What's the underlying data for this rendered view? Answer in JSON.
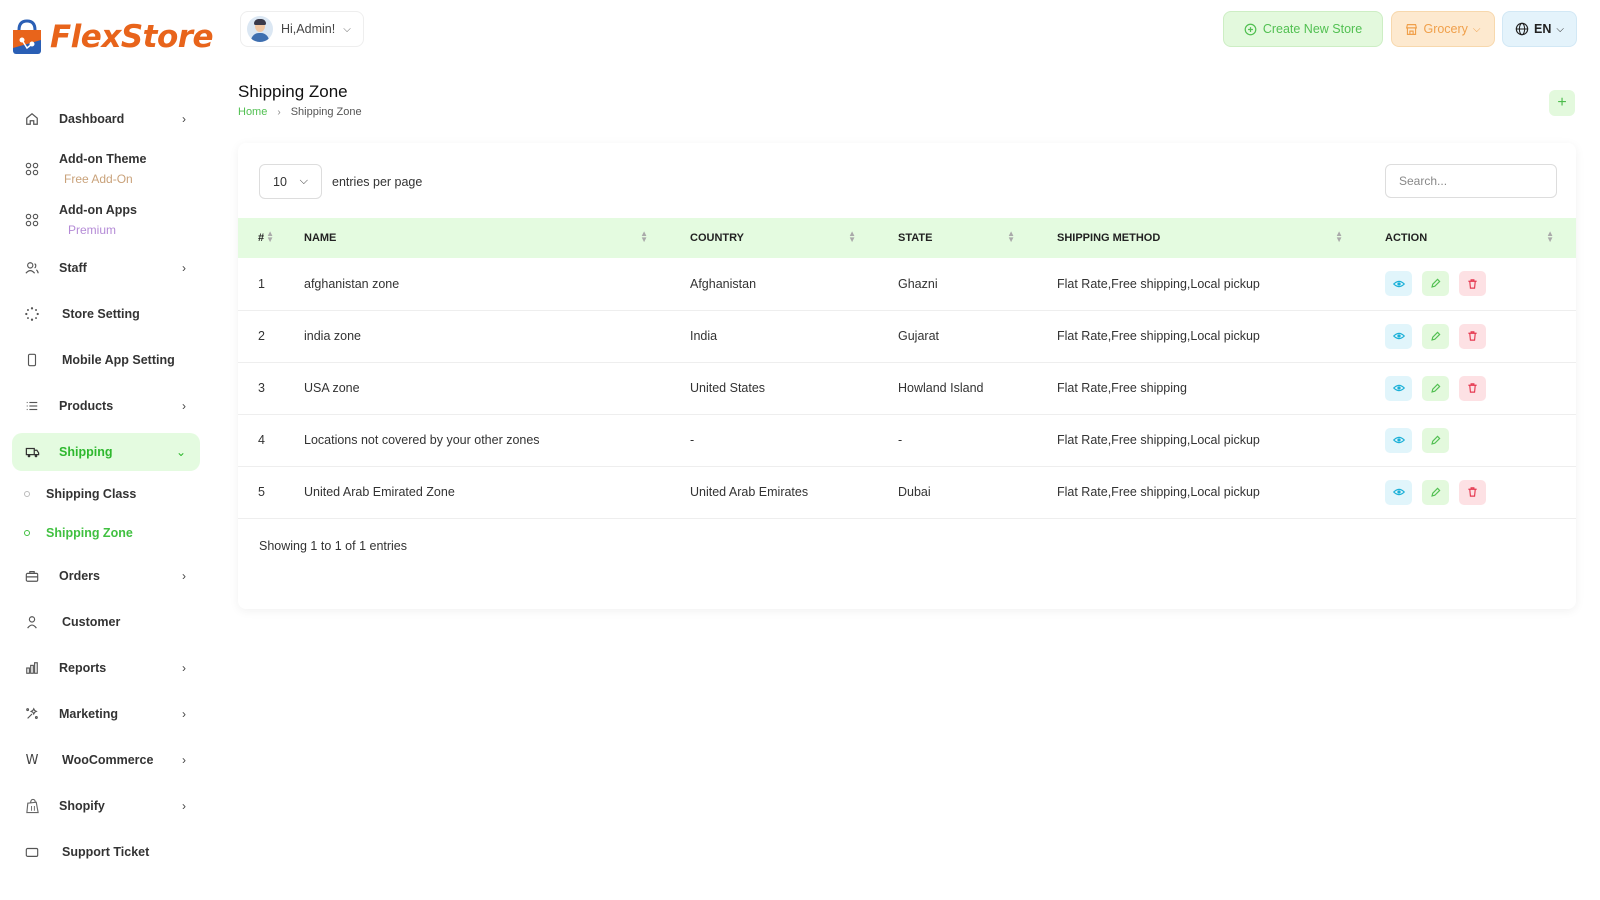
{
  "brand": {
    "name": "FlexStore"
  },
  "colors": {
    "accent": "#52c052",
    "accent_bg": "#e4fbe0",
    "brand": "#e8641b",
    "danger": "#e53950",
    "info": "#1ab0d8",
    "warning": "#f0a04b"
  },
  "header": {
    "user_greeting": "Hi,Admin!",
    "create_store_label": "Create New Store",
    "store_type_label": "Grocery",
    "language_label": "EN"
  },
  "sidebar": {
    "items": [
      {
        "label": "Dashboard",
        "icon": "home-icon"
      },
      {
        "label": "Add-on Theme",
        "sub": "Free Add-On",
        "icon": "grid-icon"
      },
      {
        "label": "Add-on Apps",
        "sub": "Premium",
        "icon": "grid-icon"
      },
      {
        "label": "Staff",
        "icon": "users-icon"
      },
      {
        "label": "Store Setting",
        "icon": "loader-icon"
      },
      {
        "label": "Mobile App Setting",
        "icon": "mobile-icon"
      },
      {
        "label": "Products",
        "icon": "list-icon"
      },
      {
        "label": "Shipping",
        "icon": "truck-icon"
      },
      {
        "label": "Orders",
        "icon": "briefcase-icon"
      },
      {
        "label": "Customer",
        "icon": "user-icon"
      },
      {
        "label": "Reports",
        "icon": "chart-icon"
      },
      {
        "label": "Marketing",
        "icon": "sparkle-icon"
      },
      {
        "label": "WooCommerce",
        "icon": "woo-icon"
      },
      {
        "label": "Shopify",
        "icon": "shopify-icon"
      },
      {
        "label": "Support Ticket",
        "icon": "ticket-icon"
      }
    ],
    "shipping_sub": [
      {
        "label": "Shipping Class"
      },
      {
        "label": "Shipping Zone"
      }
    ]
  },
  "page": {
    "title": "Shipping Zone",
    "breadcrumb": {
      "home": "Home",
      "current": "Shipping Zone"
    },
    "add_label": "+"
  },
  "table": {
    "per_page_value": "10",
    "per_page_label": "entries per page",
    "search_placeholder": "Search...",
    "columns": [
      "#",
      "NAME",
      "COUNTRY",
      "STATE",
      "SHIPPING METHOD",
      "ACTION"
    ],
    "rows": [
      {
        "num": "1",
        "name": "afghanistan zone",
        "country": "Afghanistan",
        "state": "Ghazni",
        "method": "Flat Rate,Free shipping,Local pickup",
        "deletable": true
      },
      {
        "num": "2",
        "name": "india zone",
        "country": "India",
        "state": "Gujarat",
        "method": "Flat Rate,Free shipping,Local pickup",
        "deletable": true
      },
      {
        "num": "3",
        "name": "USA zone",
        "country": "United States",
        "state": "Howland Island",
        "method": "Flat Rate,Free shipping",
        "deletable": true
      },
      {
        "num": "4",
        "name": "Locations not covered by your other zones",
        "country": "-",
        "state": "-",
        "method": "Flat Rate,Free shipping,Local pickup",
        "deletable": false
      },
      {
        "num": "5",
        "name": "United Arab Emirated Zone",
        "country": "United Arab Emirates",
        "state": "Dubai",
        "method": "Flat Rate,Free shipping,Local pickup",
        "deletable": true
      }
    ],
    "showing_text": "Showing 1 to 1 of 1 entries"
  }
}
